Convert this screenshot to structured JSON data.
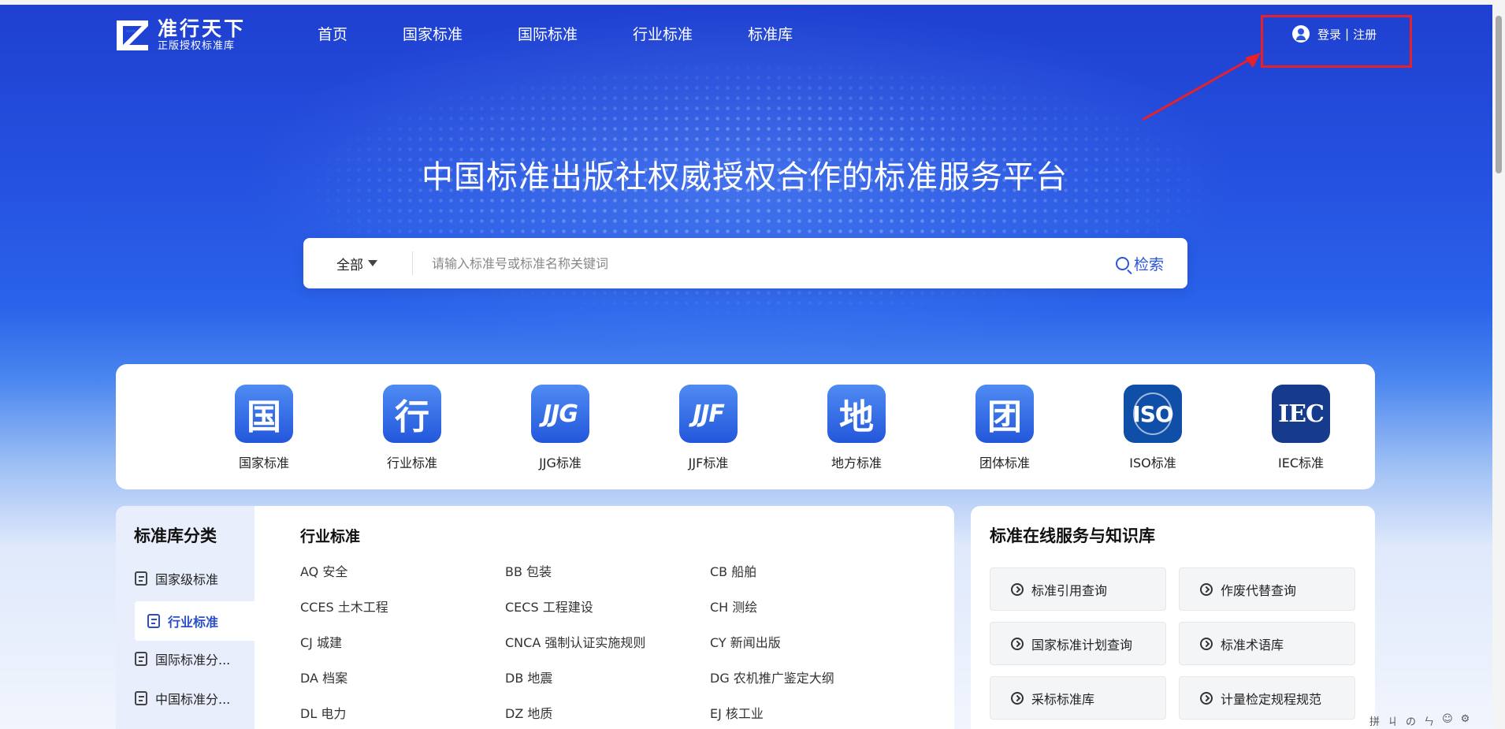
{
  "header": {
    "logo_title": "准行天下",
    "logo_subtitle": "正版授权标准库",
    "nav": [
      "首页",
      "国家标准",
      "国际标准",
      "行业标准",
      "标准库"
    ],
    "login_label": "登录",
    "separator": "|",
    "register_label": "注册"
  },
  "hero": {
    "slogan": "中国标准出版社权威授权合作的标准服务平台"
  },
  "search": {
    "scope": "全部",
    "placeholder": "请输入标准号或标准名称关键词",
    "button": "检索"
  },
  "categories": [
    {
      "glyph": "国",
      "label": "国家标准"
    },
    {
      "glyph": "行",
      "label": "行业标准"
    },
    {
      "glyph": "JJG",
      "label": "JJG标准"
    },
    {
      "glyph": "JJF",
      "label": "JJF标准"
    },
    {
      "glyph": "地",
      "label": "地方标准"
    },
    {
      "glyph": "团",
      "label": "团体标准"
    },
    {
      "glyph": "ISO",
      "label": "ISO标准"
    },
    {
      "glyph": "IEC",
      "label": "IEC标准"
    }
  ],
  "library": {
    "title": "标准库分类",
    "side_items": [
      "国家级标准",
      "行业标准",
      "国际标准分...",
      "中国标准分..."
    ],
    "main_title": "行业标准",
    "entries": [
      "AQ 安全",
      "BB 包装",
      "CB 船舶",
      "CCES 土木工程",
      "CECS 工程建设",
      "CH 测绘",
      "CJ 城建",
      "CNCA 强制认证实施规则",
      "CY 新闻出版",
      "DA 档案",
      "DB 地震",
      "DG 农机推广鉴定大纲",
      "DL 电力",
      "DZ 地质",
      "EJ 核工业"
    ]
  },
  "services": {
    "title": "标准在线服务与知识库",
    "items": [
      "标准引用查询",
      "作废代替查询",
      "国家标准计划查询",
      "标准术语库",
      "采标标准库",
      "计量检定规程规范"
    ]
  },
  "ime": {
    "items": [
      "拼",
      "ㄐ",
      "の",
      "ㄣ",
      "☺",
      "⚙"
    ]
  },
  "colors": {
    "accent": "#2a55de",
    "highlight": "#e8202a"
  }
}
